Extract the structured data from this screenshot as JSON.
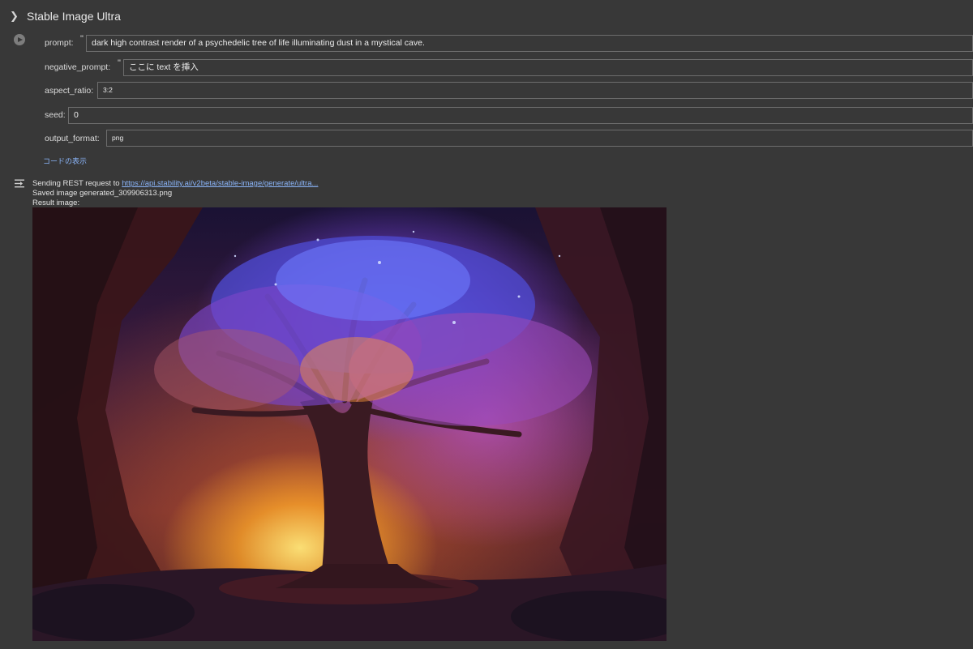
{
  "cell": {
    "title": "Stable Image Ultra",
    "show_code_link": "コードの表示"
  },
  "form": {
    "prompt": {
      "label": "prompt:",
      "quote": "\"",
      "value": "dark high contrast render of a psychedelic tree of life illuminating dust in a mystical cave."
    },
    "negative_prompt": {
      "label": "negative_prompt:",
      "quote": "\"",
      "value": "ここに text を挿入"
    },
    "aspect_ratio": {
      "label": "aspect_ratio:",
      "value": "3:2"
    },
    "seed": {
      "label": "seed:",
      "value": "0"
    },
    "output_format": {
      "label": "output_format:",
      "value": "png"
    }
  },
  "output": {
    "sending_prefix": "Sending REST request to ",
    "sending_url": "https://api.stability.ai/v2beta/stable-image/generate/ultra...",
    "saved": "Saved image generated_309906313.png",
    "result_label": "Result image:"
  }
}
